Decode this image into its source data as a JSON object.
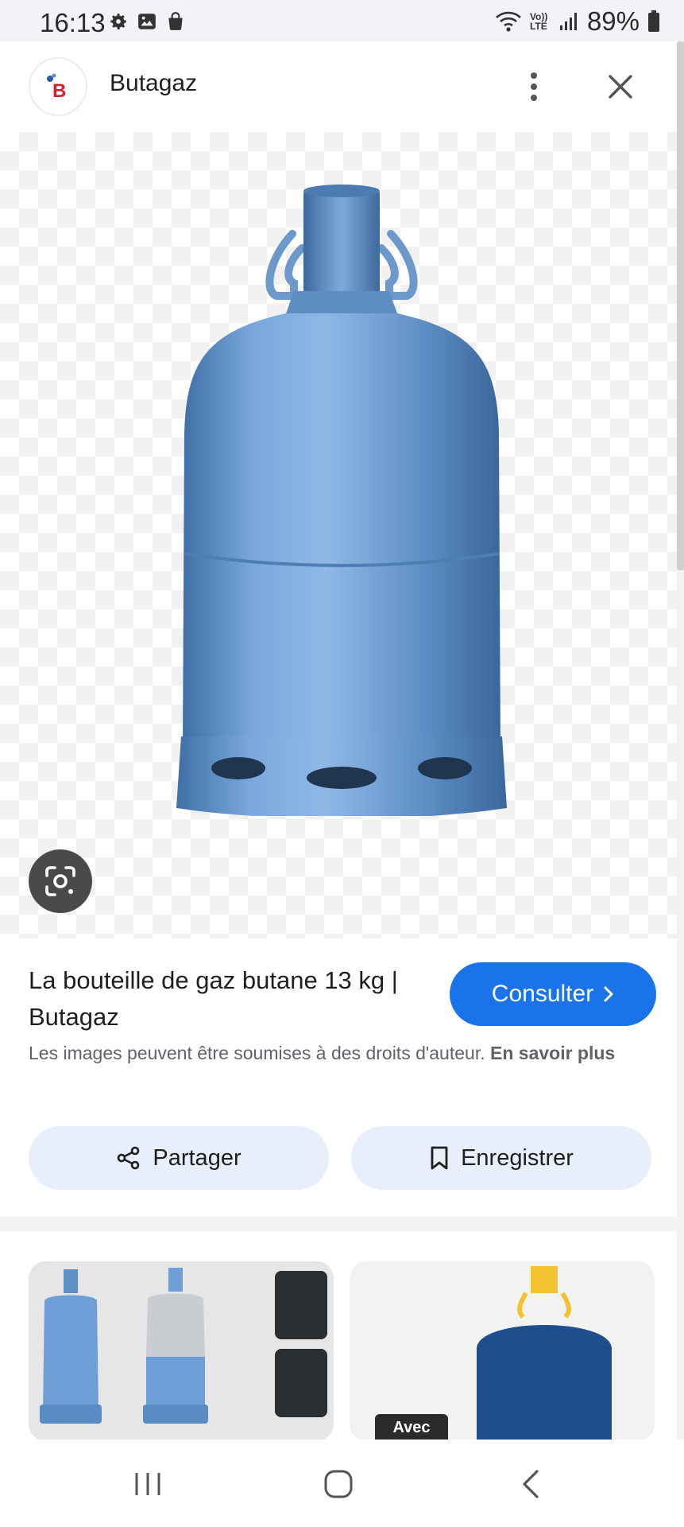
{
  "status_bar": {
    "time": "16:13",
    "left_icons": [
      "settings-icon",
      "gallery-icon",
      "shopping-bag-icon"
    ],
    "right_icons": [
      "wifi-icon",
      "volte-lte-icon",
      "signal-icon",
      "battery-icon"
    ],
    "volte_text": "Vo)) LTE",
    "battery_percent": "89%"
  },
  "header": {
    "logo_letter": "B",
    "site_name": "Butagaz",
    "menu_icon": "more-vert-icon",
    "close_icon": "close-icon"
  },
  "image": {
    "subject": "blue-gas-bottle",
    "lens_icon": "google-lens-icon"
  },
  "info": {
    "title": "La bouteille de gaz butane 13 kg | Butagaz",
    "consult_label": "Consulter",
    "copyright_text": "Les images peuvent être soumises à des droits d'auteur.",
    "learn_more": "En savoir plus",
    "share_label": "Partager",
    "save_label": "Enregistrer"
  },
  "related": {
    "thumb_2_badge": "Avec"
  },
  "nav_bar": {
    "icons": [
      "recents-icon",
      "home-icon",
      "back-icon"
    ]
  },
  "colors": {
    "accent": "#1a73e8",
    "action_button_bg": "#e8effa",
    "bottle_blue": "#6f9fd3"
  }
}
